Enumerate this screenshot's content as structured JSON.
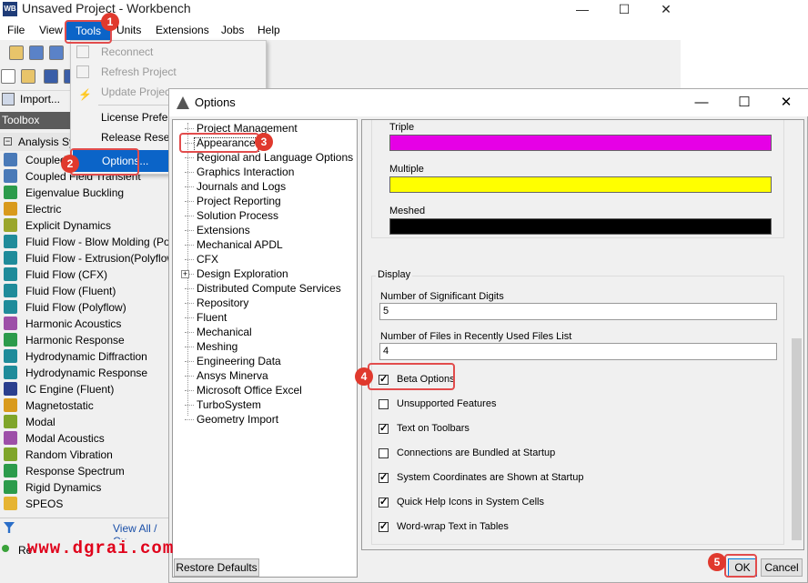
{
  "workbench": {
    "title": "Unsaved Project - Workbench",
    "logo": "WB",
    "window_controls": [
      "—",
      "☐",
      "✕"
    ],
    "menubar": [
      "File",
      "View",
      "Tools",
      "Units",
      "Extensions",
      "Jobs",
      "Help"
    ],
    "import_label": "Import..."
  },
  "tools_menu": {
    "items": [
      {
        "label": "Reconnect",
        "disabled": true,
        "icon": "reconnect-icon"
      },
      {
        "label": "Refresh Project",
        "disabled": true,
        "icon": "refresh-icon"
      },
      {
        "label": "Update Project",
        "disabled": true,
        "icon": "lightning-icon"
      },
      {
        "label": "License Prefere",
        "disabled": false
      },
      {
        "label": "Release Reserv",
        "disabled": false
      },
      {
        "label": "Options...",
        "disabled": false
      }
    ]
  },
  "toolbox": {
    "header": "Toolbox",
    "group": "Analysis Sy",
    "items": [
      {
        "label": "Coupled",
        "color": "#4a7ab8"
      },
      {
        "label": "Coupled Field Transient",
        "color": "#4a7ab8"
      },
      {
        "label": "Eigenvalue Buckling",
        "color": "#2c9b4b"
      },
      {
        "label": "Electric",
        "color": "#d99a1c"
      },
      {
        "label": "Explicit Dynamics",
        "color": "#9aa62c"
      },
      {
        "label": "Fluid Flow - Blow Molding (Poly",
        "color": "#1f8b9a"
      },
      {
        "label": "Fluid Flow - Extrusion(Polyflow)",
        "color": "#1f8b9a"
      },
      {
        "label": "Fluid Flow (CFX)",
        "color": "#1f8b9a"
      },
      {
        "label": "Fluid Flow (Fluent)",
        "color": "#1f8b9a"
      },
      {
        "label": "Fluid Flow (Polyflow)",
        "color": "#1f8b9a"
      },
      {
        "label": "Harmonic Acoustics",
        "color": "#9d4fa8"
      },
      {
        "label": "Harmonic Response",
        "color": "#2c9b4b"
      },
      {
        "label": "Hydrodynamic Diffraction",
        "color": "#1f8b9a"
      },
      {
        "label": "Hydrodynamic Response",
        "color": "#1f8b9a"
      },
      {
        "label": "IC Engine (Fluent)",
        "color": "#2b3f8e"
      },
      {
        "label": "Magnetostatic",
        "color": "#d99a1c"
      },
      {
        "label": "Modal",
        "color": "#7fa52a"
      },
      {
        "label": "Modal Acoustics",
        "color": "#9d4fa8"
      },
      {
        "label": "Random Vibration",
        "color": "#7fa52a"
      },
      {
        "label": "Response Spectrum",
        "color": "#2c9b4b"
      },
      {
        "label": "Rigid Dynamics",
        "color": "#2c9b4b"
      },
      {
        "label": "SPEOS",
        "color": "#e6b432"
      }
    ],
    "footer_link": "View All / Cu",
    "status_text": "Re"
  },
  "options": {
    "title": "Options",
    "window_controls": [
      "—",
      "☐",
      "✕"
    ],
    "tree": [
      "Project Management",
      "Appearance",
      "Regional and Language Options",
      "Graphics Interaction",
      "Journals and Logs",
      "Project Reporting",
      "Solution Process",
      "Extensions",
      "Mechanical APDL",
      "CFX",
      "Design Exploration",
      "Distributed Compute Services",
      "Repository",
      "Fluent",
      "Mechanical",
      "Meshing",
      "Engineering Data",
      "Ansys Minerva",
      "Microsoft Office Excel",
      "TurboSystem",
      "Geometry Import"
    ],
    "colors": [
      {
        "label": "Triple",
        "color": "#e600e6"
      },
      {
        "label": "Multiple",
        "color": "#ffff00"
      },
      {
        "label": "Meshed",
        "color": "#000000"
      }
    ],
    "display_group": "Display",
    "sig_digits_label": "Number of Significant Digits",
    "sig_digits_value": "5",
    "recent_files_label": "Number of Files in Recently Used Files List",
    "recent_files_value": "4",
    "checkboxes": [
      {
        "label": "Beta Options",
        "checked": true
      },
      {
        "label": "Unsupported Features",
        "checked": false
      },
      {
        "label": "Text on Toolbars",
        "checked": true
      },
      {
        "label": "Connections are Bundled at Startup",
        "checked": false
      },
      {
        "label": "System Coordinates are Shown at Startup",
        "checked": true
      },
      {
        "label": "Quick Help Icons in System Cells",
        "checked": true
      },
      {
        "label": "Word-wrap Text in Tables",
        "checked": true
      }
    ],
    "restore_defaults": "Restore Defaults",
    "ok": "OK",
    "cancel": "Cancel"
  },
  "callouts": [
    "1",
    "2",
    "3",
    "4",
    "5"
  ],
  "watermark": "www.dgrai.com"
}
